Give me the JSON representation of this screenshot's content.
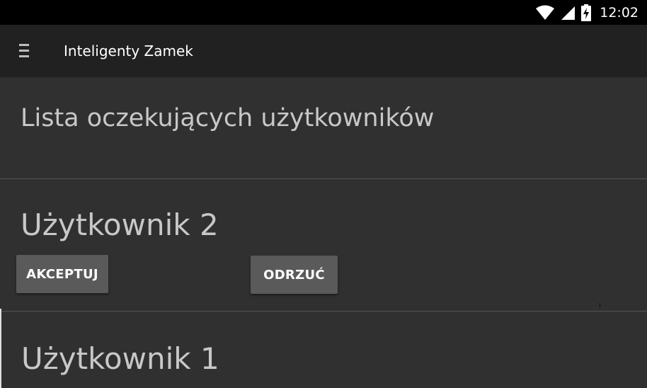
{
  "status_bar": {
    "time": "12:02",
    "icons": [
      "wifi-icon",
      "cell-signal-icon",
      "battery-charging-icon"
    ]
  },
  "app_bar": {
    "menu_icon": "hamburger-menu-icon",
    "title": "Inteligenty Zamek"
  },
  "content": {
    "section_title": "Lista oczekujących użytkowników",
    "users": [
      {
        "name": "Użytkownik 2",
        "accept_label": "AKCEPTUJ",
        "reject_label": "ODRZUĆ"
      },
      {
        "name": "Użytkownik 1"
      }
    ]
  },
  "colors": {
    "status_bar": "#000000",
    "app_bar": "#212121",
    "background": "#303030",
    "button": "#5a5a5a",
    "text_primary": "#ffffff",
    "text_secondary": "#c8c8c8"
  }
}
